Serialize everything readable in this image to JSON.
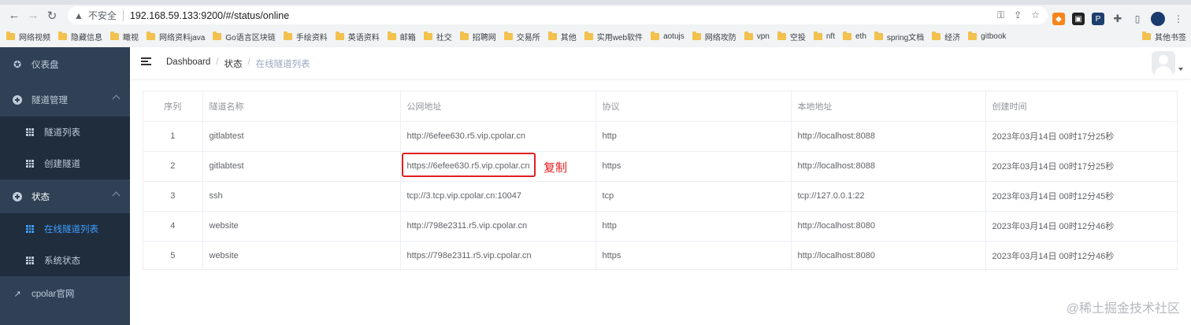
{
  "browser": {
    "insecure_label": "不安全",
    "url": "192.168.59.133:9200/#/status/online",
    "bookmarks": [
      "网络视频",
      "隐藏信息",
      "瞰视",
      "网络资料java",
      "Go语言区块链",
      "手绘资料",
      "英语资料",
      "邮箱",
      "社交",
      "招聘网",
      "交易所",
      "其他",
      "实用web软件",
      "aotujs",
      "网络攻防",
      "vpn",
      "空投",
      "nft",
      "eth",
      "spring文档",
      "经济",
      "gitbook"
    ],
    "bookmarks_right": "其他书签",
    "colors": {
      "chrome_bg": "#f1f3f4",
      "folder": "#f2c14e"
    }
  },
  "sidebar": {
    "colors": {
      "bg": "#304156",
      "sub_bg": "#1f2d3d",
      "text": "#bfcbd9",
      "active": "#409eff"
    },
    "items": [
      {
        "label": "仪表盘",
        "icon": "dashboard-icon"
      },
      {
        "label": "隧道管理",
        "icon": "plus-circle-icon"
      },
      {
        "label": "隧道列表",
        "icon": "grid-icon"
      },
      {
        "label": "创建隧道",
        "icon": "grid-icon"
      },
      {
        "label": "状态",
        "icon": "plus-circle-icon"
      },
      {
        "label": "在线隧道列表",
        "icon": "grid-icon"
      },
      {
        "label": "系统状态",
        "icon": "grid-icon"
      },
      {
        "label": "cpolar官网",
        "icon": "external-link-icon"
      }
    ]
  },
  "header": {
    "breadcrumb": [
      "Dashboard",
      "状态",
      "在线隧道列表"
    ]
  },
  "table": {
    "columns": [
      "序列",
      "隧道名称",
      "公网地址",
      "协议",
      "本地地址",
      "创建时间"
    ],
    "rows": [
      [
        "1",
        "gitlabtest",
        "http://6efee630.r5.vip.cpolar.cn",
        "http",
        "http://localhost:8088",
        "2023年03月14日 00时17分25秒"
      ],
      [
        "2",
        "gitlabtest",
        "https://6efee630.r5.vip.cpolar.cn",
        "https",
        "http://localhost:8088",
        "2023年03月14日 00时17分25秒"
      ],
      [
        "3",
        "ssh",
        "tcp://3.tcp.vip.cpolar.cn:10047",
        "tcp",
        "tcp://127.0.0.1:22",
        "2023年03月14日 00时12分45秒"
      ],
      [
        "4",
        "website",
        "http://798e2311.r5.vip.cpolar.cn",
        "http",
        "http://localhost:8080",
        "2023年03月14日 00时12分46秒"
      ],
      [
        "5",
        "website",
        "https://798e2311.r5.vip.cpolar.cn",
        "https",
        "http://localhost:8080",
        "2023年03月14日 00时12分46秒"
      ]
    ]
  },
  "annotation": {
    "copy_label": "复制",
    "color": "#e02020"
  },
  "watermark": "@稀土掘金技术社区"
}
